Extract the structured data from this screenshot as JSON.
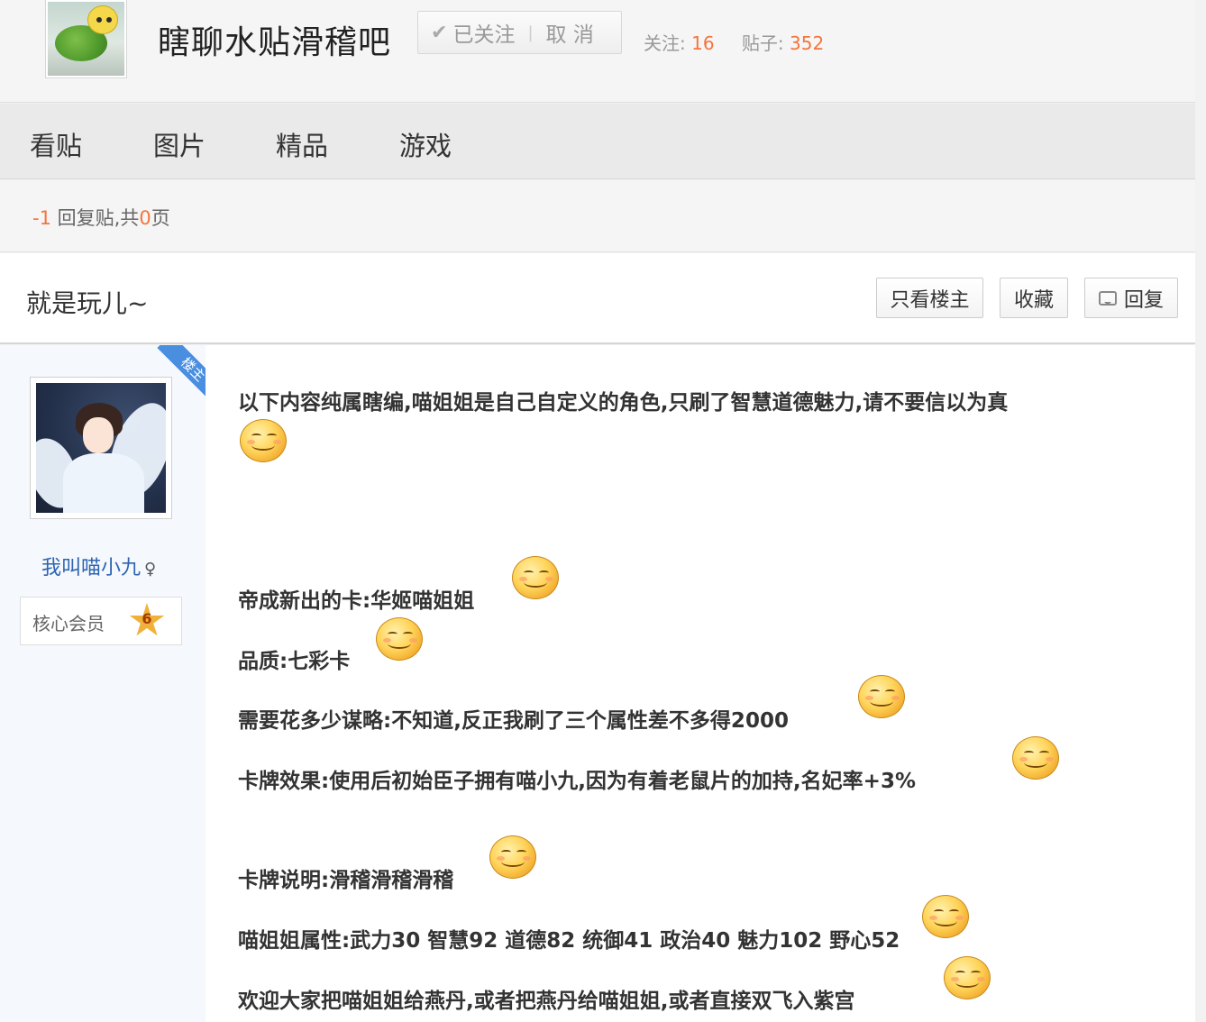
{
  "forum": {
    "name": "瞎聊水贴滑稽吧",
    "follow_label": "已关注",
    "cancel_label": "取 消",
    "follow_count_label": "关注:",
    "follow_count": "16",
    "post_count_label": "贴子:",
    "post_count": "352"
  },
  "nav": {
    "tabs": [
      "看贴",
      "图片",
      "精品",
      "游戏"
    ]
  },
  "reply_count": {
    "value": "-1",
    "mid": " 回复贴,共",
    "pages": "0",
    "end": "页"
  },
  "thread": {
    "title": "就是玩儿~",
    "only_owner_label": "只看楼主",
    "favorite_label": "收藏",
    "reply_label": "回复"
  },
  "author": {
    "ribbon": "楼主",
    "name": "我叫喵小九",
    "gender_symbol": "♀",
    "member_label": "核心会员",
    "level": "6"
  },
  "post": {
    "lines": [
      "以下内容纯属瞎编,喵姐姐是自己自定义的角色,只刷了智慧道德魅力,请不要信以为真",
      "帝成新出的卡:华姬喵姐姐",
      "品质:七彩卡",
      "需要花多少谋略:不知道,反正我刷了三个属性差不多得2000",
      "卡牌效果:使用后初始臣子拥有喵小九,因为有着老鼠片的加持,名妃率+3%",
      "卡牌说明:滑稽滑稽滑稽",
      "喵姐姐属性:武力30 智慧92 道德82 统御41 政治40 魅力102 野心52",
      "欢迎大家把喵姐姐给燕丹,或者把燕丹给喵姐姐,或者直接双飞入紫宫"
    ]
  },
  "colors": {
    "accent_orange": "#f4753d",
    "link_blue": "#2d64b3",
    "ribbon_blue": "#4a8ee0"
  }
}
